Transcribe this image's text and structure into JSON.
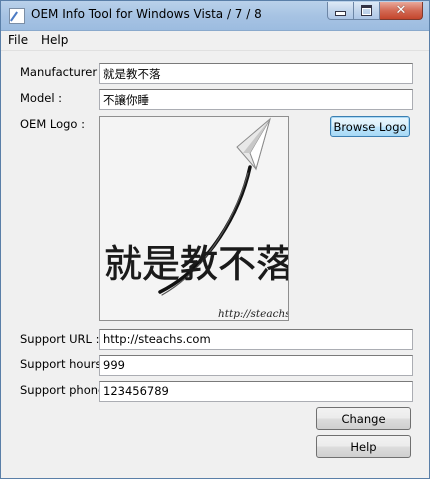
{
  "window": {
    "title": "OEM Info Tool for Windows Vista / 7 / 8",
    "close_glyph": "✕"
  },
  "menu": {
    "file": "File",
    "help": "Help"
  },
  "form": {
    "manufacturer_label": "Manufacturer :",
    "manufacturer_value": "就是教不落",
    "model_label": "Model :",
    "model_value": "不讓你睡",
    "oem_logo_label": "OEM Logo :",
    "browse_logo_button": "Browse Logo",
    "support_url_label": "Support URL :",
    "support_url_value": "http://steachs.com",
    "support_hours_label": "Support hours :",
    "support_hours_value": "999",
    "support_phone_label": "Support phone :",
    "support_phone_value": "123456789"
  },
  "logo": {
    "text": "就是教不落",
    "url_text": "http://steachs.com"
  },
  "buttons": {
    "change": "Change",
    "help": "Help"
  }
}
